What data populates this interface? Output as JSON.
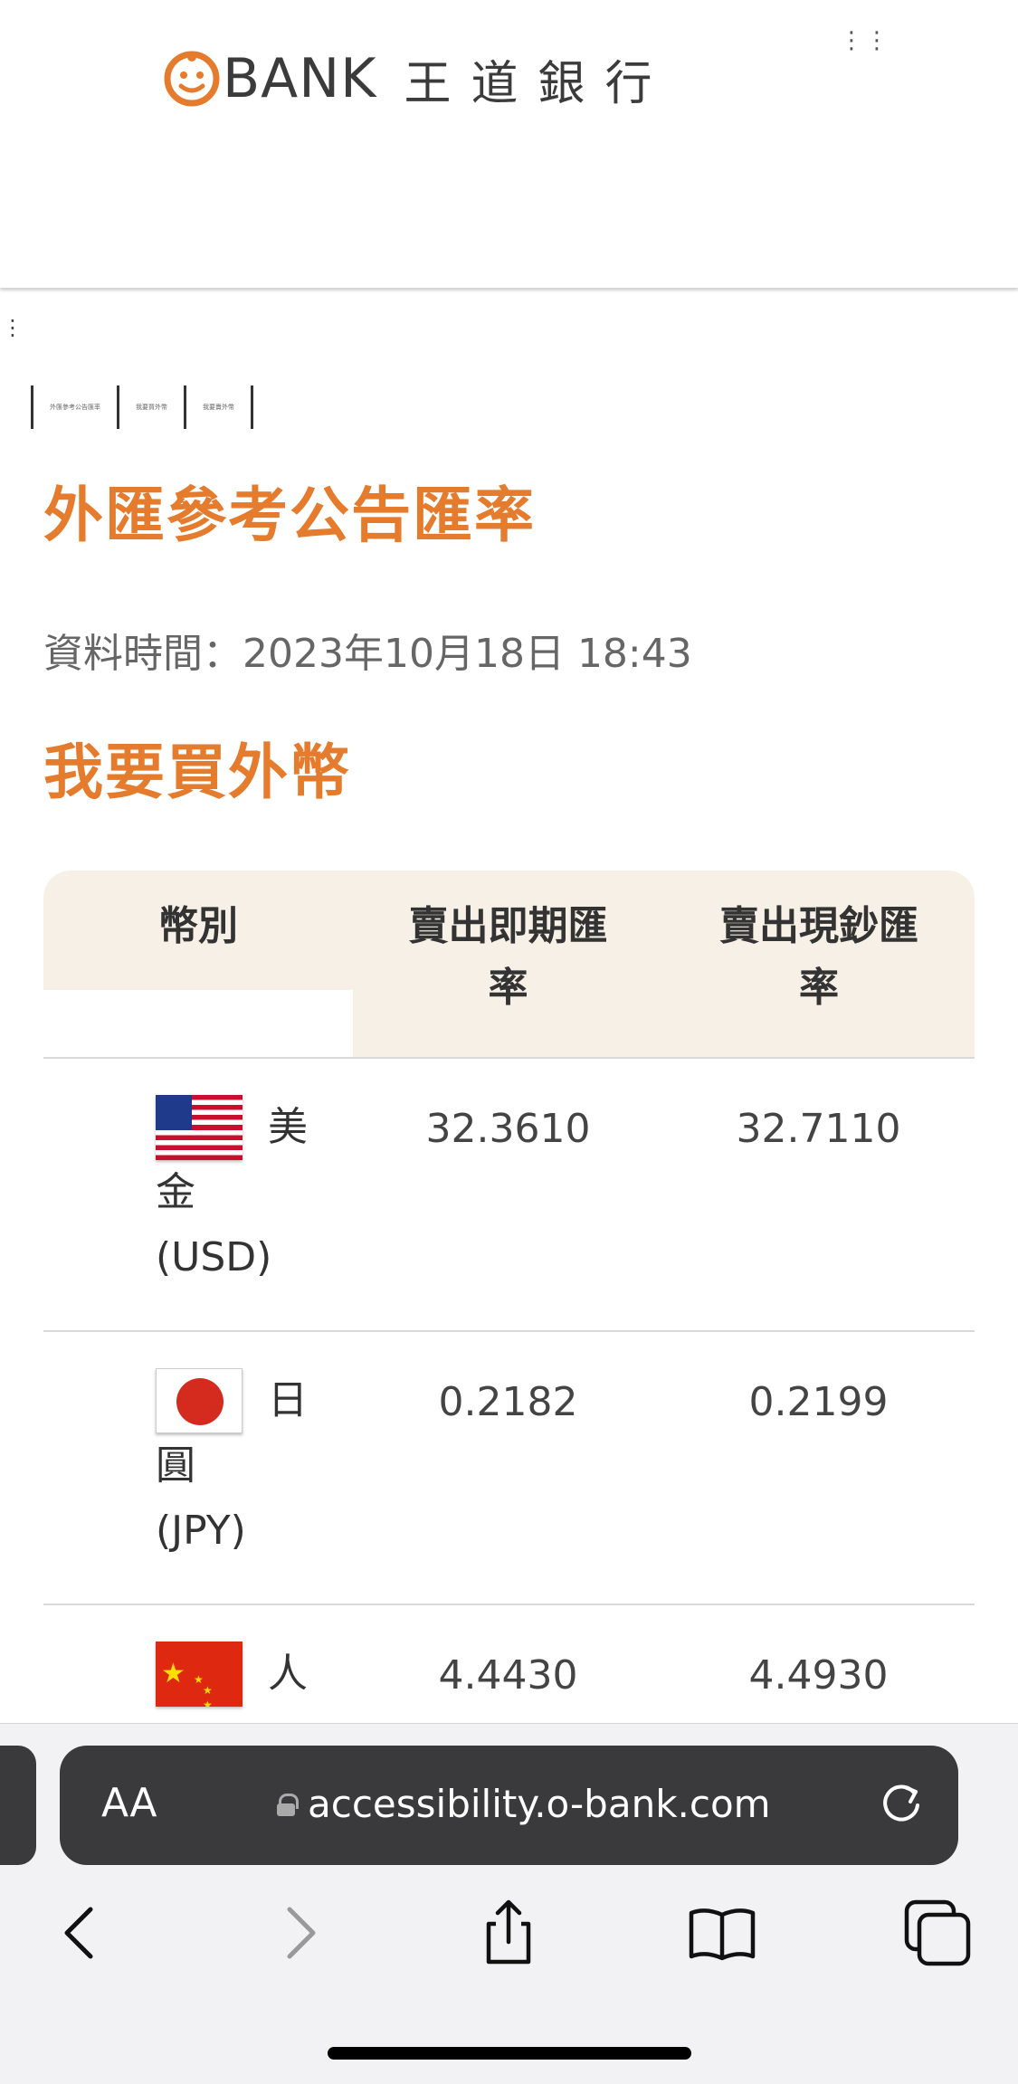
{
  "header": {
    "logo_text": "BANK",
    "logo_cn": "王道銀行",
    "menu_dots": "⋮⋮"
  },
  "side_dots": "⋮",
  "breadcrumb": {
    "items": [
      "外匯參考公告匯率",
      "我要買外幣",
      "我要賣外幣"
    ]
  },
  "page_title": "外匯參考公告匯率",
  "data_time": "資料時間：2023年10月18日 18:43",
  "section_title": "我要買外幣",
  "table": {
    "headers": {
      "currency": "幣別",
      "spot_rate": "賣出即期匯率",
      "cash_rate": "賣出現鈔匯率"
    },
    "rows": [
      {
        "flag": "us-flag-icon",
        "name_line1": "美",
        "name_line2": "金",
        "code": "(USD)",
        "spot": "32.3610",
        "cash": "32.7110"
      },
      {
        "flag": "jp-flag-icon",
        "name_line1": "日",
        "name_line2": "圓",
        "code": "(JPY)",
        "spot": "0.2182",
        "cash": "0.2199"
      },
      {
        "flag": "cn-flag-icon",
        "name_line1": "人",
        "name_line2": "",
        "code": "",
        "spot": "4.4430",
        "cash": "4.4930"
      }
    ]
  },
  "browser": {
    "text_size_label": "AA",
    "url": "accessibility.o-bank.com"
  },
  "colors": {
    "accent": "#e57b2c",
    "header_bg": "#f6f0e6",
    "urlbar_bg": "#3a3a3c"
  }
}
